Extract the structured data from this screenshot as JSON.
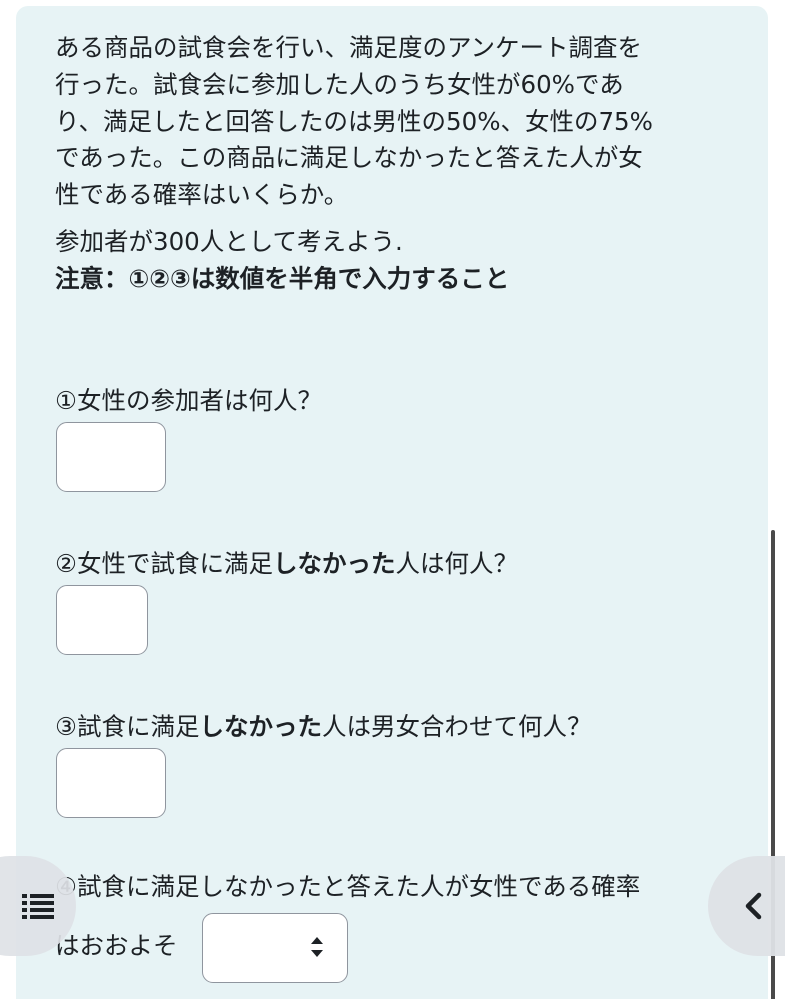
{
  "question": {
    "lines": [
      "ある商品の試食会を行い、満足度のアンケート調査を",
      "行った。試食会に参加した人のうち女性が60%であ",
      "り、満足したと回答したのは男性の50%、女性の75%",
      "であった。この商品に満足しなかったと答えた人が女",
      "性である確率はいくらか。"
    ],
    "hint": "参加者が300人として考えよう.",
    "note": "注意：①②③は数値を半角で入力すること"
  },
  "parts": [
    {
      "label": "①女性の参加者は何人？",
      "pre": "①女性の参加者は何人？",
      "bold": "",
      "post": ""
    },
    {
      "pre": "②女性で試食に満足",
      "bold": "しなかった",
      "post": "人は何人？"
    },
    {
      "pre": "③試食に満足",
      "bold": "しなかった",
      "post": "人は男女合わせて何人？"
    },
    {
      "pre": "④試食に満足しなかったと答えた人が女性である確率",
      "bold": "",
      "post": ""
    }
  ],
  "part4_line2": "はおおよそ",
  "answers": {
    "q1_value": "",
    "q2_value": "",
    "q3_value": "",
    "q4_selected": ""
  },
  "icons": {
    "drawer": "list-icon",
    "back": "chevron-left-icon",
    "select": "select-arrows-icon"
  },
  "colors": {
    "card_bg": "#e7f3f5",
    "text": "#1d2125",
    "border": "#8f959e"
  }
}
